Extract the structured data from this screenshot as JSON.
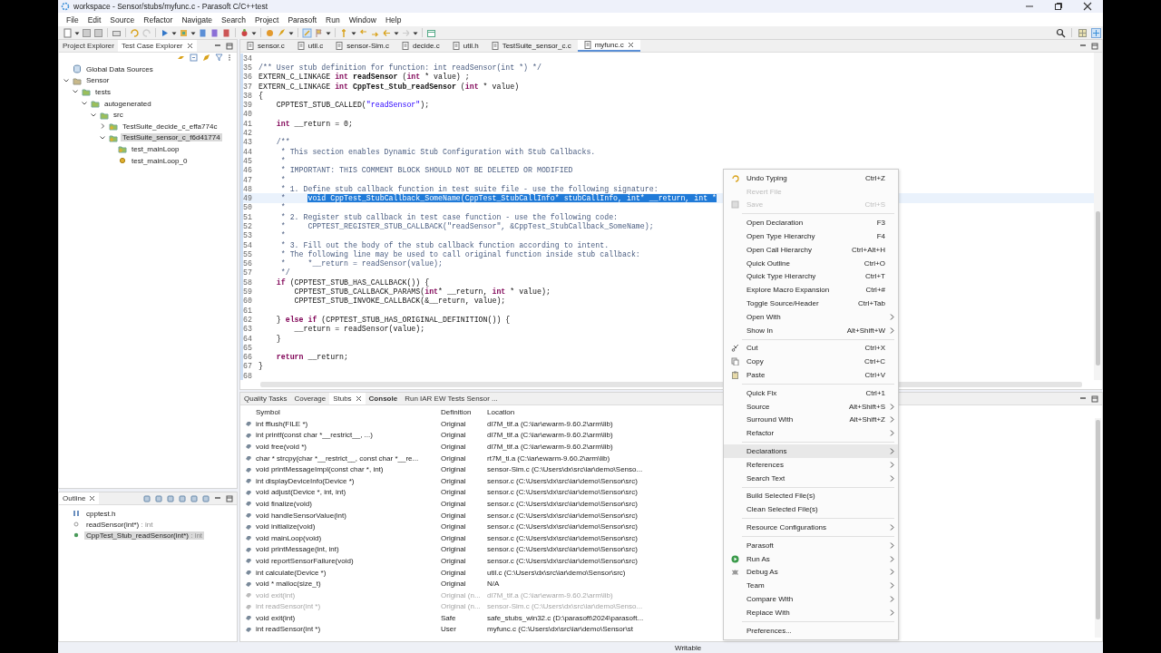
{
  "window": {
    "title": "workspace - Sensor/stubs/myfunc.c - Parasoft C/C++test"
  },
  "menu": [
    "File",
    "Edit",
    "Source",
    "Refactor",
    "Navigate",
    "Search",
    "Project",
    "Parasoft",
    "Run",
    "Window",
    "Help"
  ],
  "left_panel": {
    "tabs": [
      {
        "label": "Project Explorer",
        "selected": false
      },
      {
        "label": "Test Case Explorer",
        "selected": true
      }
    ],
    "tree": [
      {
        "label": "Global Data Sources",
        "kind": "data-sources",
        "selected": false
      },
      {
        "label": "Sensor",
        "kind": "project",
        "expanded": true,
        "selected": false,
        "children": [
          {
            "label": "tests",
            "kind": "folder",
            "expanded": true,
            "selected": false,
            "children": [
              {
                "label": "autogenerated",
                "kind": "folder",
                "expanded": true,
                "selected": false,
                "children": [
                  {
                    "label": "src",
                    "kind": "folder",
                    "expanded": true,
                    "selected": false,
                    "children": [
                      {
                        "label": "TestSuite_decide_c_effa774c",
                        "kind": "suite",
                        "expanded": false,
                        "selected": false
                      },
                      {
                        "label": "TestSuite_sensor_c_f6d41774",
                        "kind": "suite",
                        "expanded": true,
                        "selected": true,
                        "children": [
                          {
                            "label": "test_mainLoop",
                            "kind": "suite",
                            "selected": false
                          },
                          {
                            "label": "test_mainLoop_0",
                            "kind": "test",
                            "selected": false
                          }
                        ]
                      }
                    ]
                  }
                ]
              }
            ]
          }
        ]
      }
    ]
  },
  "outline": {
    "title": "Outline",
    "items": [
      {
        "name": "cpptest.h",
        "kind": "include",
        "selected": false
      },
      {
        "name": "readSensor(int*)",
        "type": " : int",
        "kind": "declaration",
        "selected": false
      },
      {
        "name": "CppTest_Stub_readSensor(int*)",
        "type": " : int",
        "kind": "function",
        "selected": true
      }
    ]
  },
  "editor": {
    "tabs": [
      {
        "label": "sensor.c",
        "selected": false
      },
      {
        "label": "util.c",
        "selected": false
      },
      {
        "label": "sensor-Sim.c",
        "selected": false
      },
      {
        "label": "decide.c",
        "selected": false
      },
      {
        "label": "util.h",
        "selected": false
      },
      {
        "label": "TestSuite_sensor_c.c",
        "selected": false
      },
      {
        "label": "myfunc.c",
        "selected": true
      }
    ],
    "lines": [
      {
        "number": "34"
      },
      {
        "number": "35",
        "segments": [
          {
            "kind": "comment",
            "text": "/** User stub definition for function: int readSensor(int *) */"
          }
        ]
      },
      {
        "number": "36",
        "segments": [
          {
            "kind": "plain",
            "text": "EXTERN_C_LINKAGE "
          },
          {
            "kind": "keyword",
            "text": "int"
          },
          {
            "kind": "bold",
            "text": " readSensor"
          },
          {
            "kind": "plain",
            "text": " ("
          },
          {
            "kind": "keyword",
            "text": "int"
          },
          {
            "kind": "plain",
            "text": " * value) ;"
          }
        ]
      },
      {
        "number": "37",
        "segments": [
          {
            "kind": "plain",
            "text": "EXTERN_C_LINKAGE "
          },
          {
            "kind": "keyword",
            "text": "int"
          },
          {
            "kind": "bold",
            "text": " CppTest_Stub_readSensor"
          },
          {
            "kind": "plain",
            "text": " ("
          },
          {
            "kind": "keyword",
            "text": "int"
          },
          {
            "kind": "plain",
            "text": " * value)"
          }
        ]
      },
      {
        "number": "38",
        "segments": [
          {
            "kind": "plain",
            "text": "{"
          }
        ]
      },
      {
        "number": "39",
        "segments": [
          {
            "kind": "plain",
            "text": "    CPPTEST_STUB_CALLED("
          },
          {
            "kind": "string",
            "text": "\"readSensor\""
          },
          {
            "kind": "plain",
            "text": ");"
          }
        ]
      },
      {
        "number": "40"
      },
      {
        "number": "41",
        "segments": [
          {
            "kind": "keyword",
            "text": "    int"
          },
          {
            "kind": "plain",
            "text": " __return = 0;"
          }
        ]
      },
      {
        "number": "42"
      },
      {
        "number": "43",
        "segments": [
          {
            "kind": "comment",
            "text": "    /**"
          }
        ]
      },
      {
        "number": "44",
        "segments": [
          {
            "kind": "comment",
            "text": "     * This section enables Dynamic Stub Configuration with Stub Callbacks."
          }
        ]
      },
      {
        "number": "45",
        "segments": [
          {
            "kind": "comment",
            "text": "     *"
          }
        ]
      },
      {
        "number": "46",
        "segments": [
          {
            "kind": "comment",
            "text": "     * IMPORTANT: THIS COMMENT BLOCK SHOULD NOT BE DELETED OR MODIFIED"
          }
        ]
      },
      {
        "number": "47",
        "segments": [
          {
            "kind": "comment",
            "text": "     *"
          }
        ]
      },
      {
        "number": "48",
        "segments": [
          {
            "kind": "comment",
            "text": "     * 1. Define stub callback function in test suite file - use the following signature:"
          }
        ]
      },
      {
        "number": "49",
        "current": true,
        "segments": [
          {
            "kind": "comment",
            "text": "     *     "
          },
          {
            "kind": "selection",
            "text": "void CppTest_StubCallback_SomeName(CppTest_StubCallInfo* stubCallInfo, int* __return, int *"
          }
        ]
      },
      {
        "number": "50",
        "segments": [
          {
            "kind": "comment",
            "text": "     *"
          }
        ]
      },
      {
        "number": "51",
        "segments": [
          {
            "kind": "comment",
            "text": "     * 2. Register stub callback in test case function - use the following code:"
          }
        ]
      },
      {
        "number": "52",
        "segments": [
          {
            "kind": "comment",
            "text": "     *     CPPTEST_REGISTER_STUB_CALLBACK(\"readSensor\", &CppTest_StubCallback_SomeName);"
          }
        ]
      },
      {
        "number": "53",
        "segments": [
          {
            "kind": "comment",
            "text": "     *"
          }
        ]
      },
      {
        "number": "54",
        "segments": [
          {
            "kind": "comment",
            "text": "     * 3. Fill out the body of the stub callback function according to intent."
          }
        ]
      },
      {
        "number": "55",
        "segments": [
          {
            "kind": "comment",
            "text": "     * The following line may be used to call original function inside stub callback:"
          }
        ]
      },
      {
        "number": "56",
        "segments": [
          {
            "kind": "comment",
            "text": "     *     *__return = readSensor(value);"
          }
        ]
      },
      {
        "number": "57",
        "segments": [
          {
            "kind": "comment",
            "text": "     */"
          }
        ]
      },
      {
        "number": "58",
        "segments": [
          {
            "kind": "keyword",
            "text": "    if"
          },
          {
            "kind": "plain",
            "text": " (CPPTEST_STUB_HAS_CALLBACK()) {"
          }
        ]
      },
      {
        "number": "59",
        "segments": [
          {
            "kind": "plain",
            "text": "        CPPTEST_STUB_CALLBACK_PARAMS("
          },
          {
            "kind": "keyword",
            "text": "int"
          },
          {
            "kind": "plain",
            "text": "* __return, "
          },
          {
            "kind": "keyword",
            "text": "int"
          },
          {
            "kind": "plain",
            "text": " * value);"
          }
        ]
      },
      {
        "number": "60",
        "segments": [
          {
            "kind": "plain",
            "text": "        CPPTEST_STUB_INVOKE_CALLBACK(&__return, value);"
          }
        ]
      },
      {
        "number": "61"
      },
      {
        "number": "62",
        "segments": [
          {
            "kind": "plain",
            "text": "    } "
          },
          {
            "kind": "keyword",
            "text": "else if"
          },
          {
            "kind": "plain",
            "text": " (CPPTEST_STUB_HAS_ORIGINAL_DEFINITION()) {"
          }
        ]
      },
      {
        "number": "63",
        "segments": [
          {
            "kind": "plain",
            "text": "        __return = readSensor(value);"
          }
        ]
      },
      {
        "number": "64",
        "segments": [
          {
            "kind": "plain",
            "text": "    }"
          }
        ]
      },
      {
        "number": "65"
      },
      {
        "number": "66",
        "segments": [
          {
            "kind": "keyword",
            "text": "    return"
          },
          {
            "kind": "plain",
            "text": " __return;"
          }
        ]
      },
      {
        "number": "67",
        "segments": [
          {
            "kind": "plain",
            "text": "}"
          }
        ]
      },
      {
        "number": "68"
      }
    ]
  },
  "bottom_panel": {
    "tabs": [
      {
        "label": "Quality Tasks",
        "selected": false,
        "emphasized": false
      },
      {
        "label": "Coverage",
        "selected": false,
        "emphasized": false
      },
      {
        "label": "Stubs",
        "selected": true,
        "emphasized": false
      },
      {
        "label": "Console",
        "selected": false,
        "emphasized": true
      },
      {
        "label": "Run IAR EW Tests Sensor ...",
        "selected": false,
        "emphasized": false
      }
    ],
    "table": {
      "columns": [
        "Symbol",
        "Definition",
        "Location"
      ],
      "rows": [
        {
          "symbol": "int fflush(FILE *)",
          "definition": "Original",
          "location": "dl7M_tlf.a  (C:\\iar\\ewarm-9.60.2\\arm\\lib)",
          "disabled": false
        },
        {
          "symbol": "int printf(const char *__restrict__, ...)",
          "definition": "Original",
          "location": "dl7M_tlf.a  (C:\\iar\\ewarm-9.60.2\\arm\\lib)",
          "disabled": false
        },
        {
          "symbol": "void free(void *)",
          "definition": "Original",
          "location": "dl7M_tlf.a  (C:\\iar\\ewarm-9.60.2\\arm\\lib)",
          "disabled": false
        },
        {
          "symbol": "char * strcpy(char *__restrict__, const char *__re...",
          "definition": "Original",
          "location": "rt7M_tl.a  (C:\\iar\\ewarm-9.60.2\\arm\\lib)",
          "disabled": false
        },
        {
          "symbol": "void printMessageImpl(const char *, int)",
          "definition": "Original",
          "location": "sensor-Sim.c  (C:\\Users\\dx\\src\\iar\\demo\\Senso...",
          "disabled": false
        },
        {
          "symbol": "int displayDeviceInfo(Device *)",
          "definition": "Original",
          "location": "sensor.c  (C:\\Users\\dx\\src\\iar\\demo\\Sensor\\src)",
          "disabled": false
        },
        {
          "symbol": "void adjust(Device *, int, int)",
          "definition": "Original",
          "location": "sensor.c  (C:\\Users\\dx\\src\\iar\\demo\\Sensor\\src)",
          "disabled": false
        },
        {
          "symbol": "void finalize(void)",
          "definition": "Original",
          "location": "sensor.c  (C:\\Users\\dx\\src\\iar\\demo\\Sensor\\src)",
          "disabled": false
        },
        {
          "symbol": "void handleSensorValue(int)",
          "definition": "Original",
          "location": "sensor.c  (C:\\Users\\dx\\src\\iar\\demo\\Sensor\\src)",
          "disabled": false
        },
        {
          "symbol": "void initialize(void)",
          "definition": "Original",
          "location": "sensor.c  (C:\\Users\\dx\\src\\iar\\demo\\Sensor\\src)",
          "disabled": false
        },
        {
          "symbol": "void mainLoop(void)",
          "definition": "Original",
          "location": "sensor.c  (C:\\Users\\dx\\src\\iar\\demo\\Sensor\\src)",
          "disabled": false
        },
        {
          "symbol": "void printMessage(int, int)",
          "definition": "Original",
          "location": "sensor.c  (C:\\Users\\dx\\src\\iar\\demo\\Sensor\\src)",
          "disabled": false
        },
        {
          "symbol": "void reportSensorFailure(void)",
          "definition": "Original",
          "location": "sensor.c  (C:\\Users\\dx\\src\\iar\\demo\\Sensor\\src)",
          "disabled": false
        },
        {
          "symbol": "int calculate(Device *)",
          "definition": "Original",
          "location": "util.c  (C:\\Users\\dx\\src\\iar\\demo\\Sensor\\src)",
          "disabled": false
        },
        {
          "symbol": "void * malloc(size_t)",
          "definition": "Original",
          "location": "N/A",
          "disabled": false
        },
        {
          "symbol": "void exit(int)",
          "definition": "Original (n...",
          "location": "dl7M_tlf.a  (C:\\iar\\ewarm-9.60.2\\arm\\lib)",
          "disabled": true
        },
        {
          "symbol": "int readSensor(int *)",
          "definition": "Original (n...",
          "location": "sensor-Sim.c  (C:\\Users\\dx\\src\\iar\\demo\\Senso...",
          "disabled": true
        },
        {
          "symbol": "void exit(int)",
          "definition": "Safe",
          "location": "safe_stubs_win32.c  (D:\\parasoft\\2024\\parasoft...",
          "disabled": false
        },
        {
          "symbol": "int readSensor(int *)",
          "definition": "User",
          "location": "myfunc.c  (C:\\Users\\dx\\src\\iar\\demo\\Sensor\\st",
          "disabled": false
        }
      ]
    }
  },
  "status_bar": {
    "mode": "Writable"
  },
  "context_menu": {
    "groups": [
      [
        {
          "label": "Undo Typing",
          "shortcut": "Ctrl+Z",
          "kind": "undo",
          "disabled": false,
          "selected": false
        },
        {
          "label": "Revert File",
          "kind": "plain",
          "disabled": true,
          "selected": false
        },
        {
          "label": "Save",
          "shortcut": "Ctrl+S",
          "kind": "save",
          "disabled": true,
          "selected": false
        }
      ],
      [
        {
          "label": "Open Declaration",
          "shortcut": "F3",
          "kind": "plain",
          "disabled": false,
          "selected": false
        },
        {
          "label": "Open Type Hierarchy",
          "shortcut": "F4",
          "kind": "plain",
          "disabled": false,
          "selected": false
        },
        {
          "label": "Open Call Hierarchy",
          "shortcut": "Ctrl+Alt+H",
          "kind": "plain",
          "disabled": false,
          "selected": false
        },
        {
          "label": "Quick Outline",
          "shortcut": "Ctrl+O",
          "kind": "plain",
          "disabled": false,
          "selected": false
        },
        {
          "label": "Quick Type Hierarchy",
          "shortcut": "Ctrl+T",
          "kind": "plain",
          "disabled": false,
          "selected": false
        },
        {
          "label": "Explore Macro Expansion",
          "shortcut": "Ctrl+#",
          "kind": "plain",
          "disabled": false,
          "selected": false
        },
        {
          "label": "Toggle Source/Header",
          "shortcut": "Ctrl+Tab",
          "kind": "plain",
          "disabled": false,
          "selected": false
        },
        {
          "label": "Open With",
          "submenu": true,
          "kind": "plain",
          "disabled": false,
          "selected": false
        },
        {
          "label": "Show In",
          "shortcut": "Alt+Shift+W",
          "submenu": true,
          "kind": "plain",
          "disabled": false,
          "selected": false
        }
      ],
      [
        {
          "label": "Cut",
          "shortcut": "Ctrl+X",
          "kind": "cut",
          "disabled": false,
          "selected": false
        },
        {
          "label": "Copy",
          "shortcut": "Ctrl+C",
          "kind": "copy",
          "disabled": false,
          "selected": false
        },
        {
          "label": "Paste",
          "shortcut": "Ctrl+V",
          "kind": "paste",
          "disabled": false,
          "selected": false
        }
      ],
      [
        {
          "label": "Quick Fix",
          "shortcut": "Ctrl+1",
          "kind": "plain",
          "disabled": false,
          "selected": false
        },
        {
          "label": "Source",
          "shortcut": "Alt+Shift+S",
          "submenu": true,
          "kind": "plain",
          "disabled": false,
          "selected": false
        },
        {
          "label": "Surround With",
          "shortcut": "Alt+Shift+Z",
          "submenu": true,
          "kind": "plain",
          "disabled": false,
          "selected": false
        },
        {
          "label": "Refactor",
          "submenu": true,
          "kind": "plain",
          "disabled": false,
          "selected": false
        }
      ],
      [
        {
          "label": "Declarations",
          "submenu": true,
          "kind": "plain",
          "disabled": false,
          "selected": true
        },
        {
          "label": "References",
          "submenu": true,
          "kind": "plain",
          "disabled": false,
          "selected": false
        },
        {
          "label": "Search Text",
          "submenu": true,
          "kind": "plain",
          "disabled": false,
          "selected": false
        }
      ],
      [
        {
          "label": "Build Selected File(s)",
          "kind": "plain",
          "disabled": false,
          "selected": false
        },
        {
          "label": "Clean Selected File(s)",
          "kind": "plain",
          "disabled": false,
          "selected": false
        }
      ],
      [
        {
          "label": "Resource Configurations",
          "submenu": true,
          "kind": "plain",
          "disabled": false,
          "selected": false
        }
      ],
      [
        {
          "label": "Parasoft",
          "submenu": true,
          "kind": "plain",
          "disabled": false,
          "selected": false
        },
        {
          "label": "Run As",
          "submenu": true,
          "kind": "run",
          "disabled": false,
          "selected": false
        },
        {
          "label": "Debug As",
          "submenu": true,
          "kind": "debug",
          "disabled": false,
          "selected": false
        },
        {
          "label": "Team",
          "submenu": true,
          "kind": "plain",
          "disabled": false,
          "selected": false
        },
        {
          "label": "Compare With",
          "submenu": true,
          "kind": "plain",
          "disabled": false,
          "selected": false
        },
        {
          "label": "Replace With",
          "submenu": true,
          "kind": "plain",
          "disabled": false,
          "selected": false
        }
      ],
      [
        {
          "label": "Preferences...",
          "kind": "plain",
          "disabled": false,
          "selected": false
        }
      ]
    ]
  }
}
